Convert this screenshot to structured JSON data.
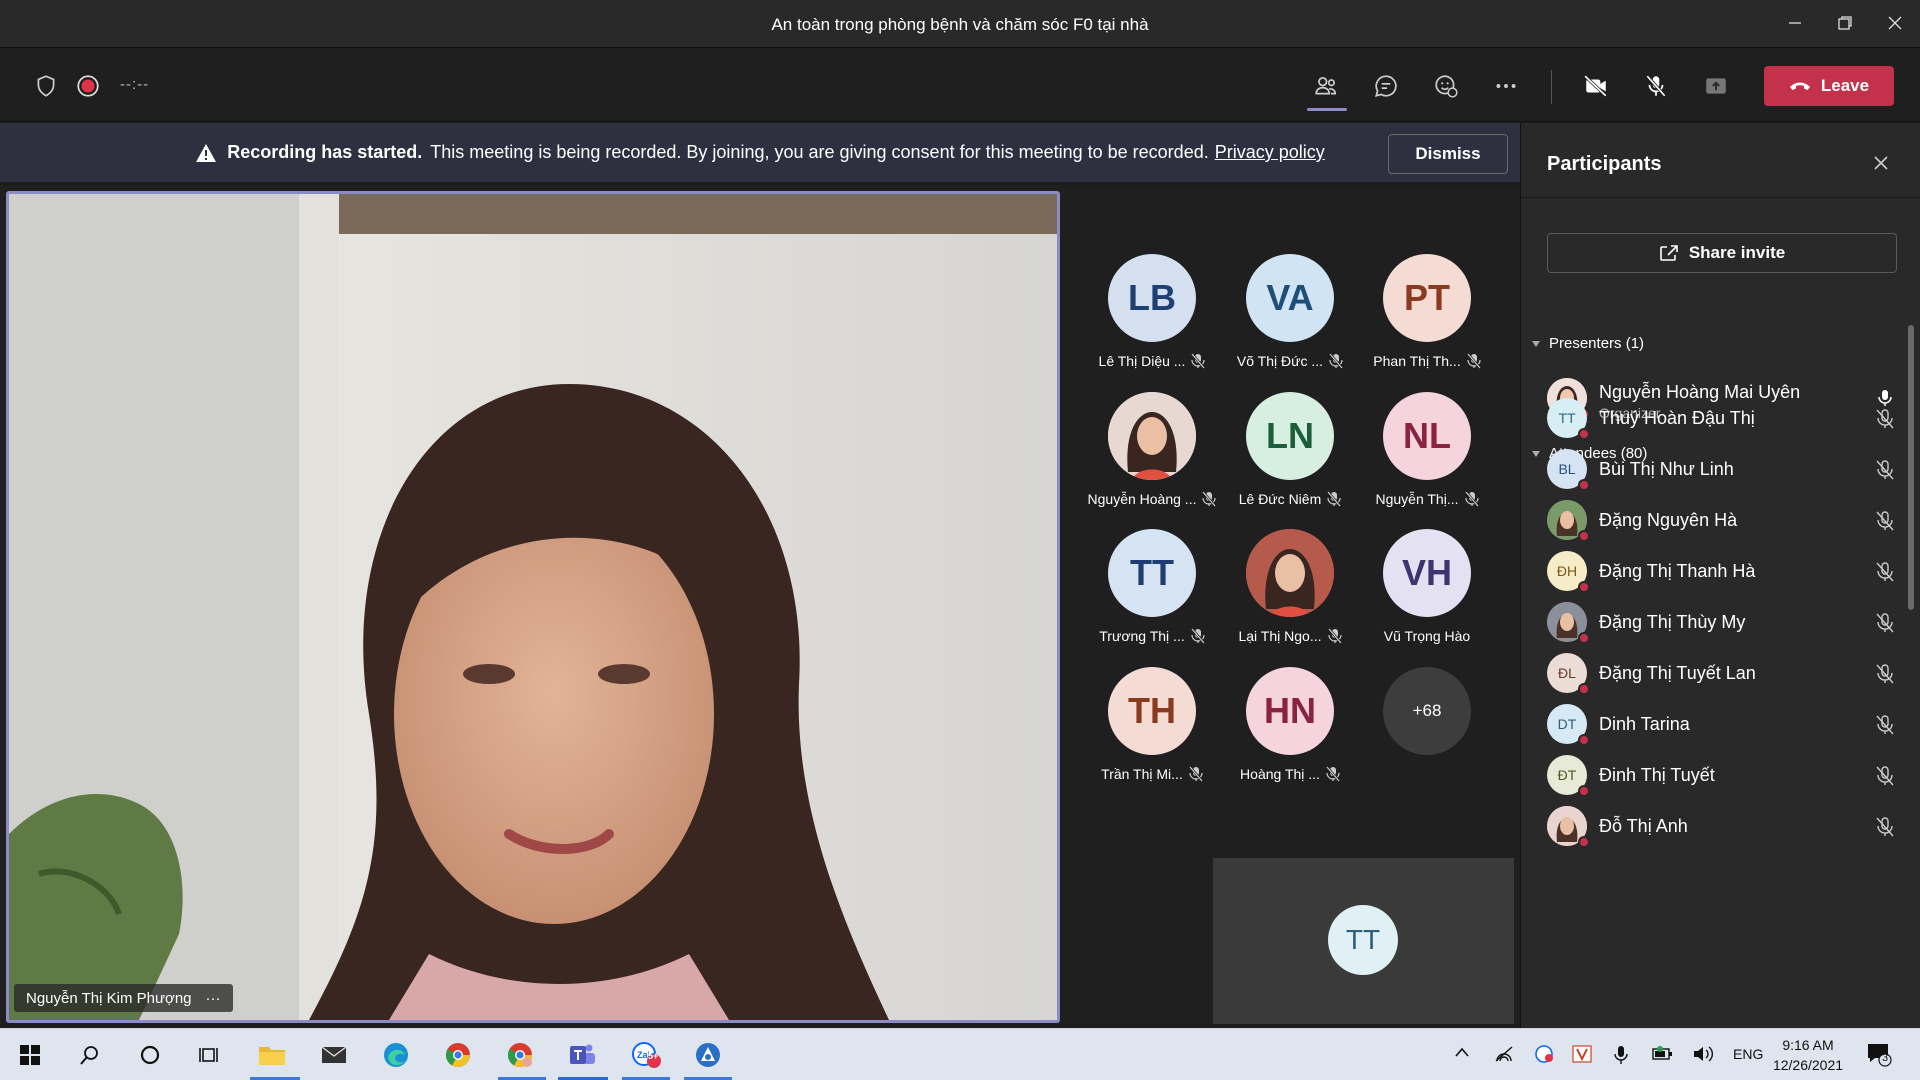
{
  "window": {
    "title": "An toàn trong phòng bệnh và chăm sóc F0 tại nhà",
    "minimize": "—",
    "restore": "❐",
    "close": "✕"
  },
  "toolbar": {
    "timer": "--:--",
    "leave_label": "Leave"
  },
  "banner": {
    "bold": "Recording has started.",
    "text": "This meeting is being recorded. By joining, you are giving consent for this meeting to be recorded.",
    "privacy_link": "Privacy policy",
    "dismiss_label": "Dismiss"
  },
  "main_video": {
    "speaker_name": "Nguyễn Thị Kim Phượng",
    "more": "···"
  },
  "gallery": {
    "tiles": [
      {
        "initials": "LB",
        "name": "Lê Thị Diệu ...",
        "bg": "#d4dff0",
        "fg": "#1f3f73"
      },
      {
        "initials": "VA",
        "name": "Võ Thị Đức ...",
        "bg": "#d0e4f3",
        "fg": "#1d4f7a"
      },
      {
        "initials": "PT",
        "name": "Phan Thị Th...",
        "bg": "#f4dcd4",
        "fg": "#8a3a1e"
      },
      {
        "initials": "",
        "name": "Nguyễn Hoàng ...",
        "bg": "#e8d8d2",
        "fg": "#333"
      },
      {
        "initials": "LN",
        "name": "Lê Đức Niêm",
        "bg": "#d6efe0",
        "fg": "#1d5e3a"
      },
      {
        "initials": "NL",
        "name": "Nguyễn Thị...",
        "bg": "#f6d4dd",
        "fg": "#8a2343"
      },
      {
        "initials": "TT",
        "name": "Trương Thị ...",
        "bg": "#d6e3f2",
        "fg": "#1f3f73"
      },
      {
        "initials": "",
        "name": "Lại Thị Ngo...",
        "bg": "#b65b4b",
        "fg": "#fff"
      },
      {
        "initials": "VH",
        "name": "Vũ Trọng Hào",
        "bg": "#e4e1f2",
        "fg": "#3d3570"
      },
      {
        "initials": "TH",
        "name": "Trần Thị Mi...",
        "bg": "#f4dcd4",
        "fg": "#8a3a1e"
      },
      {
        "initials": "HN",
        "name": "Hoàng Thị ...",
        "bg": "#f6d4dd",
        "fg": "#8a2343"
      }
    ],
    "more_count": "+68",
    "self_initials": "TT"
  },
  "participants": {
    "title": "Participants",
    "share_label": "Share invite",
    "presenters_label": "Presenters (1)",
    "attendees_label": "Attendees (80)",
    "presenter": {
      "name": "Nguyễn Hoàng Mai Uyên",
      "role": "Organizer"
    },
    "attendees": [
      {
        "name": "Thuý Hoàn Đậu Thị",
        "initials": "TT",
        "bg": "#d6eef4",
        "fg": "#2b6b80"
      },
      {
        "name": "Bùi Thị Như Linh",
        "initials": "BL",
        "bg": "#d6e3f2",
        "fg": "#2b4f80"
      },
      {
        "name": "Đặng Nguyên Hà",
        "initials": "",
        "bg": "#7a9a6a",
        "fg": "#fff"
      },
      {
        "name": "Đặng Thị Thanh Hà",
        "initials": "ĐH",
        "bg": "#f7ecc8",
        "fg": "#7a5a10"
      },
      {
        "name": "Đặng Thị Thùy My",
        "initials": "",
        "bg": "#8a8f9a",
        "fg": "#fff"
      },
      {
        "name": "Đặng Thị Tuyết Lan",
        "initials": "ĐL",
        "bg": "#ecdcd6",
        "fg": "#6a3a2a"
      },
      {
        "name": "Dinh Tarina",
        "initials": "DT",
        "bg": "#d6e9f4",
        "fg": "#2b5f80"
      },
      {
        "name": "Đinh Thị Tuyết",
        "initials": "ĐT",
        "bg": "#e6ead6",
        "fg": "#4a5a20"
      },
      {
        "name": "Đỗ Thị Anh",
        "initials": "",
        "bg": "#e9d4d0",
        "fg": "#333"
      }
    ]
  },
  "taskbar": {
    "lang": "ENG",
    "time": "9:16 AM",
    "date": "12/26/2021",
    "notif_count": "3",
    "zalo_badge": "5+"
  },
  "colors": {
    "accent": "#8b8cc7",
    "leave": "#c4314b",
    "panel": "#292929"
  }
}
